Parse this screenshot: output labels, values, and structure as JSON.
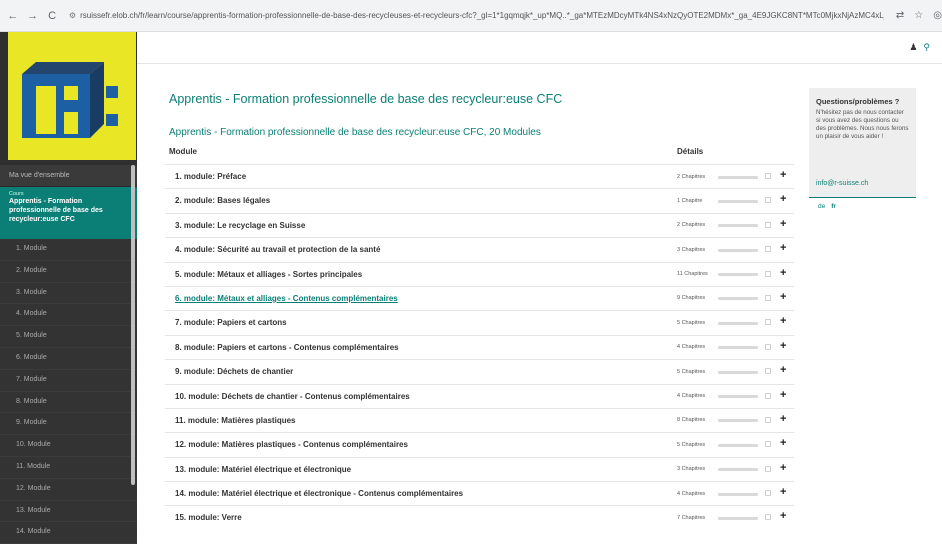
{
  "browser": {
    "back": "←",
    "forward": "→",
    "reload": "C",
    "url": "rsuissefr.elob.ch/fr/learn/course/apprentis-formation-professionnelle-de-base-des-recycleuses-et-recycleurs-cfc?_gl=1*1gqmqjk*_up*MQ..*_ga*MTEzMDcyMTk4NS4xNzQyOTE2MDMx*_ga_4E9JGKC8NT*MTc0MjkxNjAzMC4xLjAuMTc0MjkxNjAzMC4wLjAuMA..",
    "icons": [
      "translate-icon",
      "star-icon",
      "profile-icon"
    ]
  },
  "sidebar": {
    "overview_label": "Ma vue d'ensemble",
    "course_kicker": "Cours",
    "course_title": "Apprentis - Formation professionnelle de base des recycleur:euse CFC",
    "modules": [
      "1. Module",
      "2. Module",
      "3. Module",
      "4. Module",
      "5. Module",
      "6. Module",
      "7. Module",
      "8. Module",
      "9. Module",
      "10. Module",
      "11. Module",
      "12. Module",
      "13. Module",
      "14. Module"
    ]
  },
  "header": {
    "user_icon": "user-icon",
    "search_icon": "search-icon"
  },
  "main": {
    "page_title": "Apprentis - Formation professionnelle de base des recycleur:euse CFC",
    "section_title": "Apprentis - Formation professionnelle de base des recycleur:euse CFC, 20 Modules",
    "col_module": "Module",
    "col_details": "Détails",
    "modules": [
      {
        "name": "1. module: Préface",
        "chapters": "2 Chapitres",
        "progress": 0
      },
      {
        "name": "2. module: Bases légales",
        "chapters": "1 Chapitre",
        "progress": 0
      },
      {
        "name": "3. module: Le recyclage en Suisse",
        "chapters": "2 Chapitres",
        "progress": 0
      },
      {
        "name": "4. module: Sécurité au travail et protection de la santé",
        "chapters": "3 Chapitres",
        "progress": 0
      },
      {
        "name": "5. module: Métaux et alliages - Sortes principales",
        "chapters": "11 Chapitres",
        "progress": 0
      },
      {
        "name": "6. module: Métaux et alliages - Contenus complémentaires",
        "chapters": "9 Chapitres",
        "progress": 0
      },
      {
        "name": "7. module: Papiers et cartons",
        "chapters": "5 Chapitres",
        "progress": 0
      },
      {
        "name": "8. module: Papiers et cartons - Contenus complémentaires",
        "chapters": "4 Chapitres",
        "progress": 0
      },
      {
        "name": "9. module: Déchets de chantier",
        "chapters": "5 Chapitres",
        "progress": 0
      },
      {
        "name": "10. module: Déchets de chantier - Contenus complémentaires",
        "chapters": "4 Chapitres",
        "progress": 0
      },
      {
        "name": "11. module: Matières plastiques",
        "chapters": "8 Chapitres",
        "progress": 0
      },
      {
        "name": "12. module: Matières plastiques - Contenus complémentaires",
        "chapters": "5 Chapitres",
        "progress": 0
      },
      {
        "name": "13. module: Matériel électrique et électronique",
        "chapters": "3 Chapitres",
        "progress": 0
      },
      {
        "name": "14. module: Matériel électrique et électronique - Contenus complémentaires",
        "chapters": "4 Chapitres",
        "progress": 0
      },
      {
        "name": "15. module: Verre",
        "chapters": "7 Chapitres",
        "progress": 0
      }
    ]
  },
  "help": {
    "title": "Questions/problèmes ?",
    "text": "N'hésitez pas de nous contacter si vous avez des questions ou des problèmes. Nous nous ferons un plaisir de vous aider !",
    "email": "info@r-suisse.ch"
  },
  "langs": {
    "de": "de",
    "fr": "fr"
  },
  "colors": {
    "accent": "#0b7f75",
    "logo_bg": "#e8e625",
    "sidebar_bg": "#2f2f2f"
  }
}
